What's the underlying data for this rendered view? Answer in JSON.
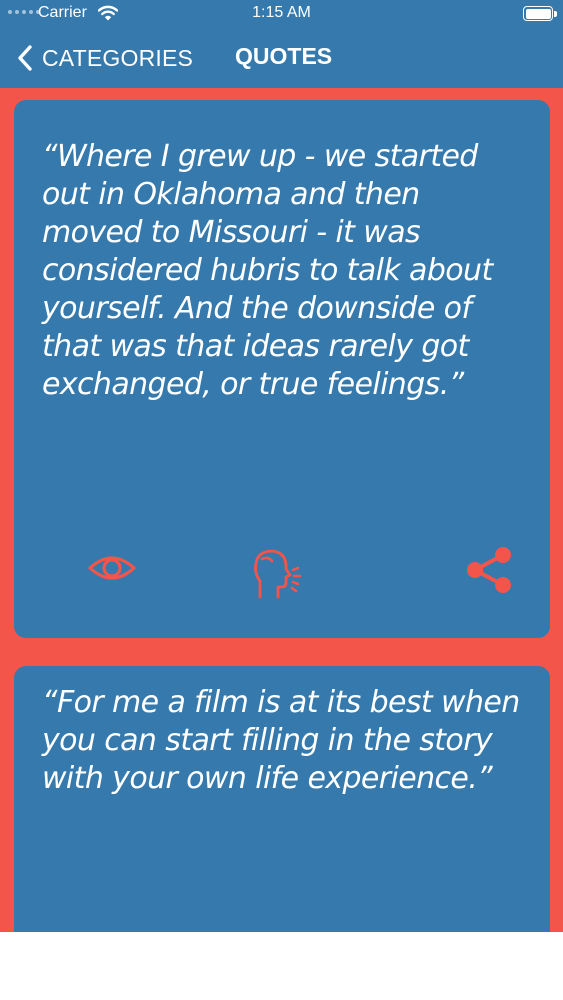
{
  "status_bar": {
    "carrier": "Carrier",
    "time": "1:15 AM"
  },
  "nav": {
    "back_label": "CATEGORIES",
    "title": "QUOTES"
  },
  "colors": {
    "header_bg": "#3579ad",
    "card_bg": "#3579ad",
    "accent_red": "#f4554a",
    "text": "#ffffff"
  },
  "quotes": [
    {
      "text": "“Where I grew up - we started out in Oklahoma and then moved to Missouri - it was considered hubris to talk about yourself. And the downside of that was that ideas rarely got exchanged, or true feelings.”",
      "actions": [
        "eye-icon",
        "speaking-head-icon",
        "share-icon"
      ]
    },
    {
      "text": "“For me a film is at its best when you can start filling in the story with your own life experience.”"
    }
  ]
}
